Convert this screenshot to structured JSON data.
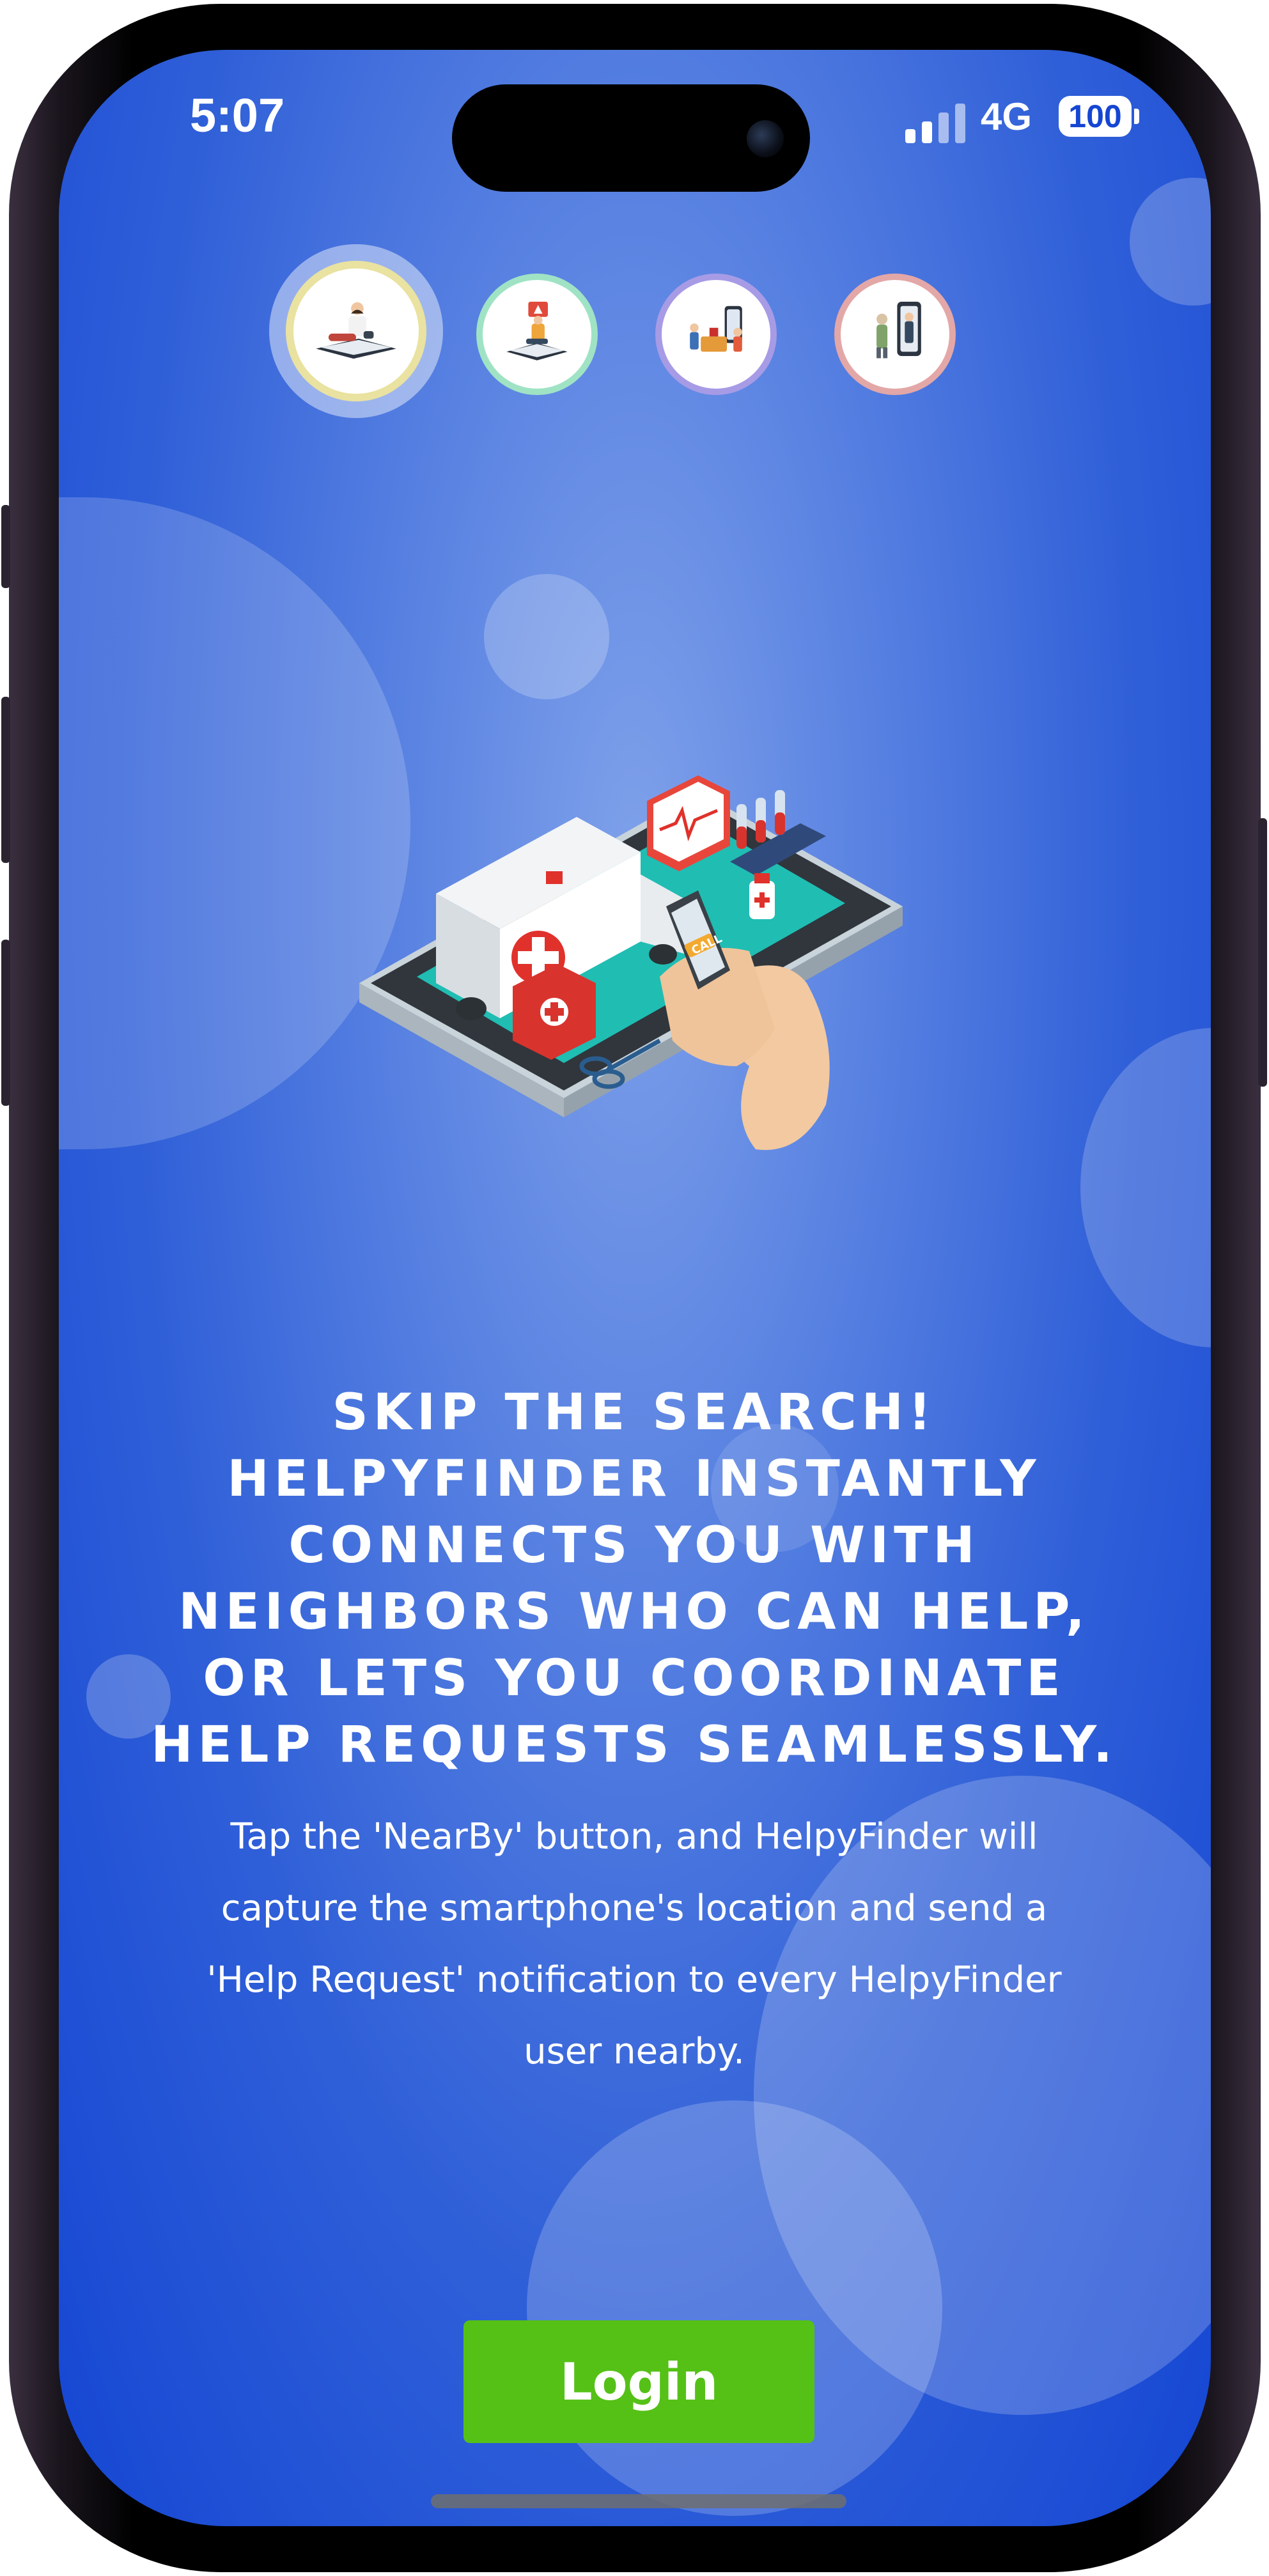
{
  "status_bar": {
    "time": "5:07",
    "network": "4G",
    "battery": "100"
  },
  "carousel": {
    "slides": [
      {
        "icon": "person-reading-phone-illustration",
        "ring_color": "#e9e2a0",
        "active": true
      },
      {
        "icon": "person-alert-phone-illustration",
        "ring_color": "#9fe3c4",
        "active": false
      },
      {
        "icon": "neighbors-helping-illustration",
        "ring_color": "#a79be6",
        "active": false
      },
      {
        "icon": "person-phone-screen-illustration",
        "ring_color": "#e3a7a7",
        "active": false
      }
    ]
  },
  "hero": {
    "icon": "emergency-phone-ambulance-illustration",
    "phone_label": "CALL"
  },
  "onboarding": {
    "headline": "SKIP THE SEARCH! HELPYFINDER INSTANTLY CONNECTS YOU WITH NEIGHBORS WHO CAN HELP, OR LETS YOU COORDINATE HELP REQUESTS SEAMLESSLY.",
    "description": "Tap the 'NearBy' button, and HelpyFinder will capture the smartphone's location and send a 'Help Request' notification to every HelpyFinder user nearby."
  },
  "actions": {
    "login_label": "Login"
  },
  "colors": {
    "background_gradient_center": "#7fa1ea",
    "background_gradient_edge": "#1546d3",
    "login_button": "#55c117",
    "text": "#ffffff"
  }
}
